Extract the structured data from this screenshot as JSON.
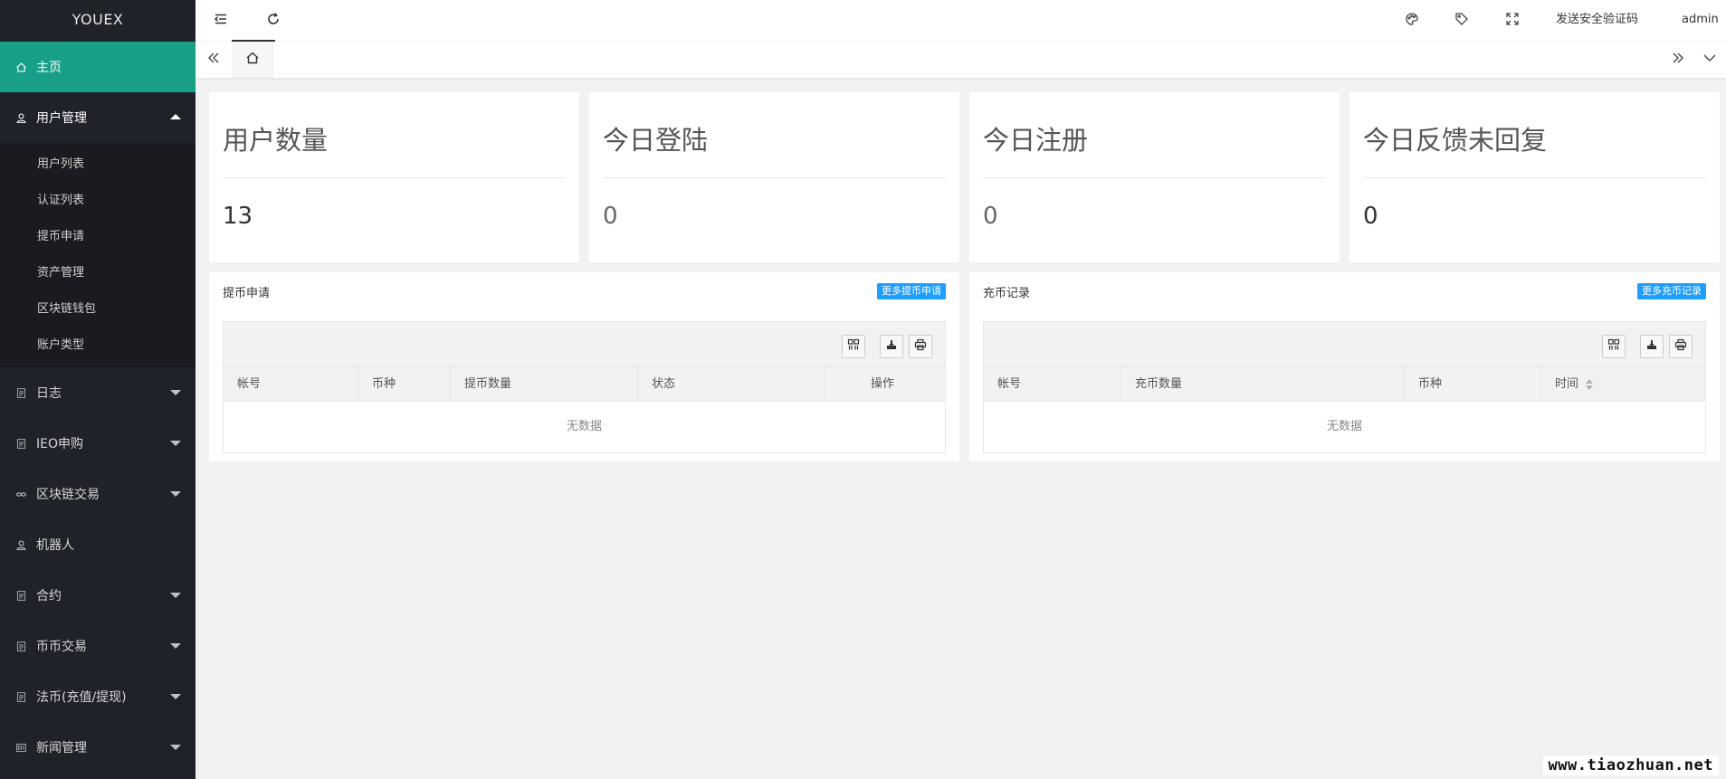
{
  "app": {
    "logo": "YOUEX"
  },
  "sidebar": {
    "home": {
      "label": "主页",
      "icon": "home-icon"
    },
    "user_mgmt": {
      "label": "用户管理",
      "icon": "user-icon",
      "children": [
        "用户列表",
        "认证列表",
        "提币申请",
        "资产管理",
        "区块链钱包",
        "账户类型"
      ]
    },
    "items": [
      {
        "label": "日志",
        "icon": "document-icon",
        "has_children": true
      },
      {
        "label": "IEO申购",
        "icon": "document-icon",
        "has_children": true
      },
      {
        "label": "区块链交易",
        "icon": "link-icon",
        "has_children": true
      },
      {
        "label": "机器人",
        "icon": "user-icon",
        "has_children": false
      },
      {
        "label": "合约",
        "icon": "document-icon",
        "has_children": true
      },
      {
        "label": "币币交易",
        "icon": "document-icon",
        "has_children": true
      },
      {
        "label": "法币(充值/提现)",
        "icon": "document-icon",
        "has_children": true
      },
      {
        "label": "新闻管理",
        "icon": "news-icon",
        "has_children": true
      }
    ]
  },
  "header": {
    "send_code_label": "发送安全验证码",
    "user_label": "admin"
  },
  "stats": [
    {
      "title": "用户数量",
      "value": "13"
    },
    {
      "title": "今日登陆",
      "value": "0"
    },
    {
      "title": "今日注册",
      "value": "0"
    },
    {
      "title": "今日反馈未回复",
      "value": "0"
    }
  ],
  "withdraw_panel": {
    "title": "提币申请",
    "more_label": "更多提币申请",
    "columns": [
      "帐号",
      "币种",
      "提币数量",
      "状态",
      "操作"
    ],
    "empty_text": "无数据"
  },
  "recharge_panel": {
    "title": "充币记录",
    "more_label": "更多充币记录",
    "columns": [
      "帐号",
      "充币数量",
      "币种",
      "时间"
    ],
    "empty_text": "无数据"
  },
  "watermark": "www.tiaozhuan.net",
  "colors": {
    "sidebar_bg": "#20222a",
    "active_nav": "#17a087",
    "more_button": "#1e9fff",
    "page_bg": "#f2f2f2"
  }
}
